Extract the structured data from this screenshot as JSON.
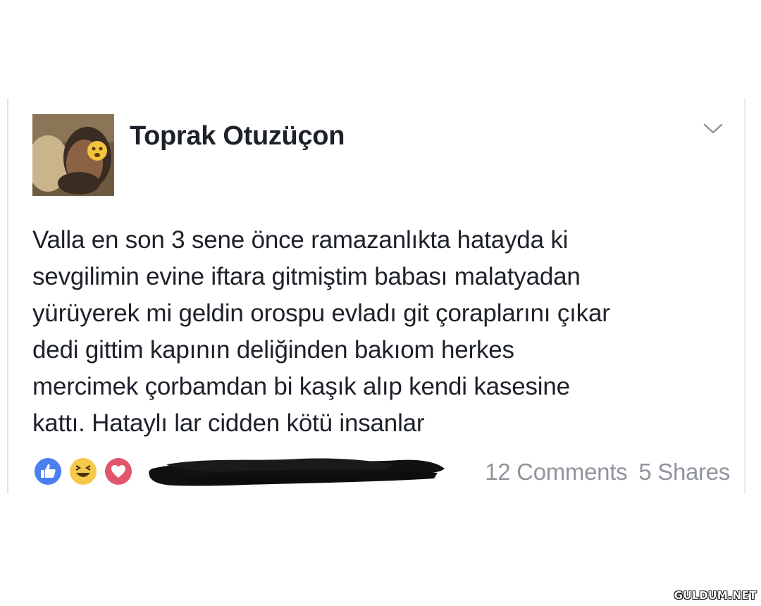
{
  "post": {
    "author": "Toprak Otuzüçon",
    "text": "Valla en son 3 sene önce ramazanlıkta hatayda ki\nsevgilimin evine iftara gitmiştim babası malatyadan\nyürüyerek mi geldin orospu evladı git çoraplarını çıkar\ndedi gittim kapının deliğinden bakıom herkes\nmercimek çorbamdan bi kaşık alıp kendi kasesine\nkattı.  Hataylı lar cidden kötü insanlar",
    "icons": {
      "menu": "chevron-down-icon",
      "reactions": [
        "like-icon",
        "haha-icon",
        "love-icon"
      ]
    },
    "comments": "12 Comments",
    "shares": "5 Shares"
  },
  "watermark": "GULDUM.NET",
  "colors": {
    "like": "#4a7ff0",
    "haha": "#f6c94a",
    "love": "#e2566b",
    "meta_text": "#90949c"
  }
}
